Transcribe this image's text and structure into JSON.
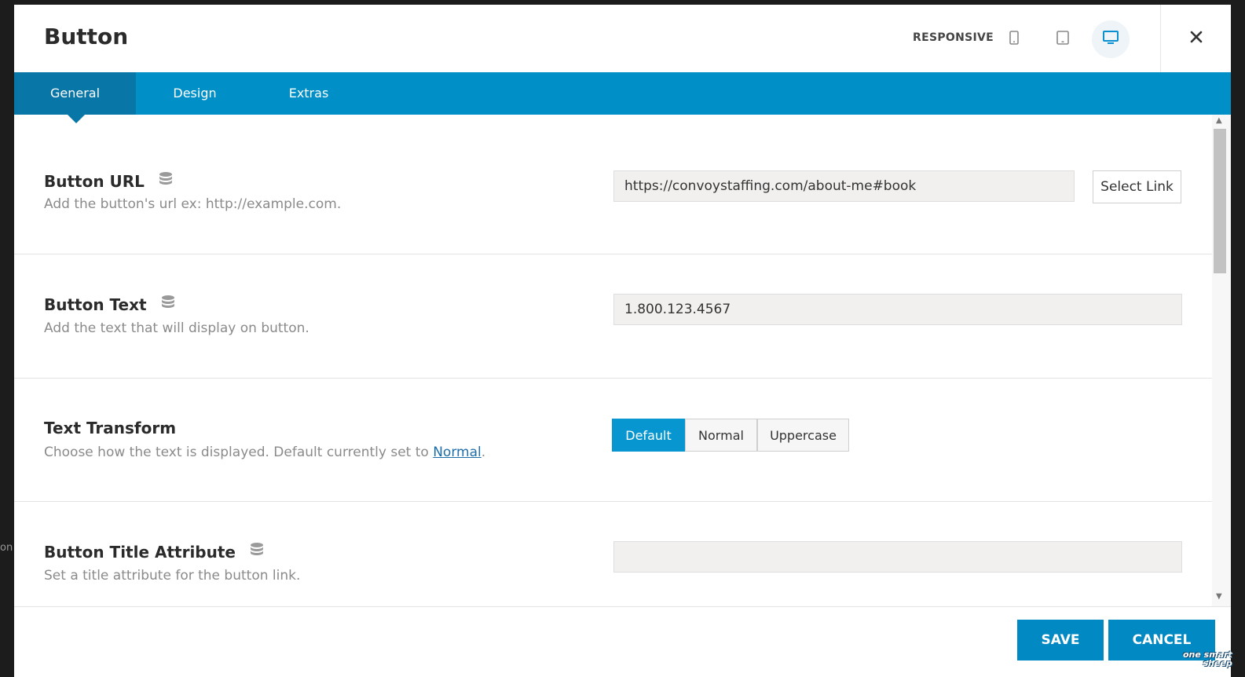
{
  "dialog": {
    "title": "Button",
    "responsive_label": "RESPONSIVE",
    "devices": [
      "phone-icon",
      "tablet-icon",
      "desktop-icon"
    ],
    "active_device": "desktop"
  },
  "tabs": [
    {
      "label": "General",
      "active": true
    },
    {
      "label": "Design",
      "active": false
    },
    {
      "label": "Extras",
      "active": false
    }
  ],
  "fields": {
    "url": {
      "label": "Button URL",
      "description": "Add the button's url ex: http://example.com.",
      "value": "https://convoystaffing.com/about-me#book",
      "select_link": "Select Link"
    },
    "text": {
      "label": "Button Text",
      "description": "Add the text that will display on button.",
      "value": "1.800.123.4567"
    },
    "transform": {
      "label": "Text Transform",
      "description_prefix": "Choose how the text is displayed. Default currently set to ",
      "description_link": "Normal",
      "description_suffix": ".",
      "options": [
        "Default",
        "Normal",
        "Uppercase"
      ],
      "selected": "Default"
    },
    "title_attr": {
      "label": "Button Title Attribute",
      "description": "Set a title attribute for the button link.",
      "value": ""
    }
  },
  "footer": {
    "save": "SAVE",
    "cancel": "CANCEL"
  },
  "watermark": [
    "one smart",
    "sheep"
  ],
  "side_fragment": "on",
  "colors": {
    "tab_bar": "#008fc6",
    "tab_active": "#0877a8",
    "accent": "#0796cf",
    "footer_button": "#0089c3"
  }
}
